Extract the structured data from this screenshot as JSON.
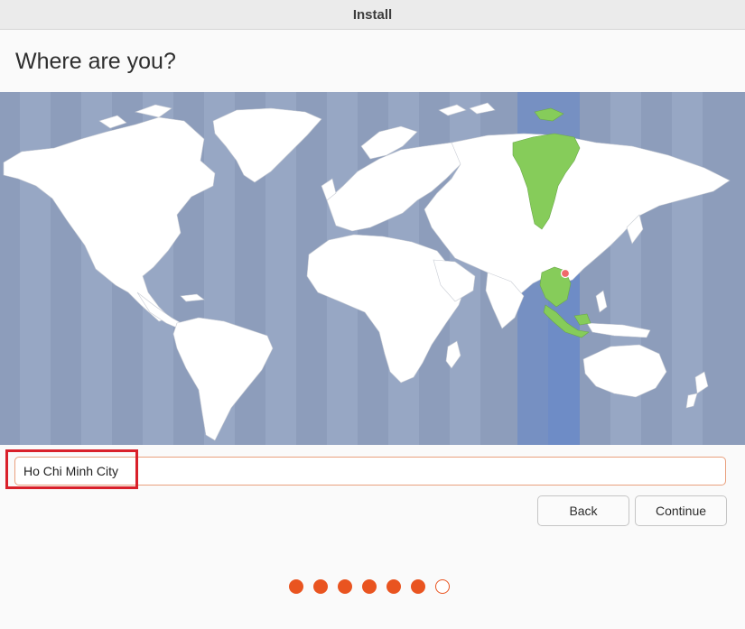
{
  "window": {
    "title": "Install"
  },
  "page": {
    "heading": "Where are you?"
  },
  "location": {
    "value": "Ho Chi Minh City"
  },
  "buttons": {
    "back": "Back",
    "continue": "Continue"
  },
  "progress": {
    "total_steps": 7,
    "current_step": 7
  },
  "colors": {
    "accent": "#e95420",
    "ocean": "#8d9dbb",
    "selected_zone": "#7690c2",
    "selected_land": "#86cc5a",
    "annotation": "#d9202a"
  }
}
